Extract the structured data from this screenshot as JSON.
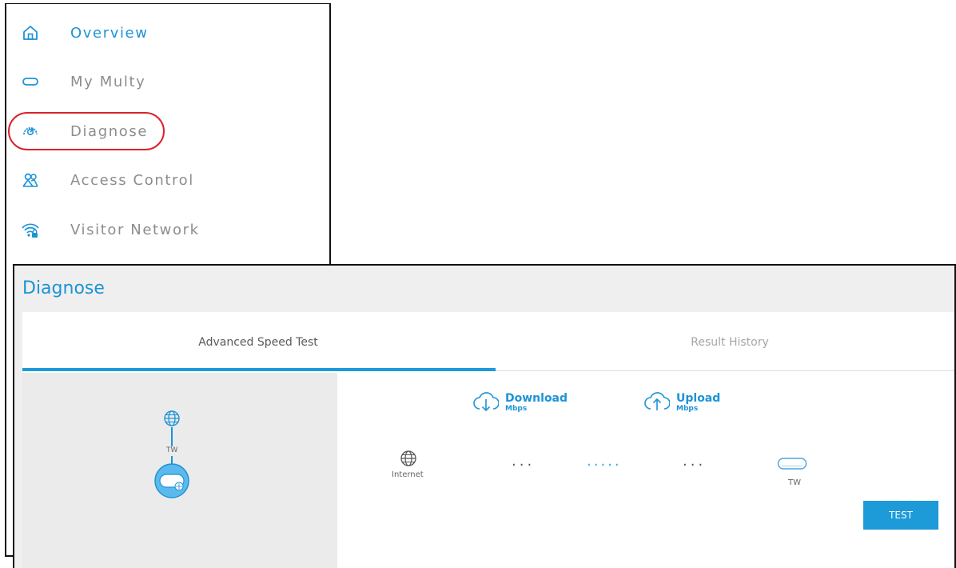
{
  "menu": {
    "items": [
      {
        "label": "Overview",
        "icon": "home-icon"
      },
      {
        "label": "My Multy",
        "icon": "router-icon"
      },
      {
        "label": "Diagnose",
        "icon": "speedometer-icon"
      },
      {
        "label": "Access Control",
        "icon": "users-icon"
      },
      {
        "label": "Visitor Network",
        "icon": "wifi-lock-icon"
      }
    ],
    "highlighted": "Diagnose",
    "highlight_color": "#d9232c"
  },
  "diagnose": {
    "title": "Diagnose",
    "tabs": [
      {
        "label": "Advanced Speed Test",
        "active": true
      },
      {
        "label": "Result History",
        "active": false
      }
    ],
    "topology": {
      "node_label": "TW"
    },
    "download": {
      "label": "Download",
      "unit": "Mbps",
      "icon": "cloud-download-icon"
    },
    "upload": {
      "label": "Upload",
      "unit": "Mbps",
      "icon": "cloud-upload-icon"
    },
    "path": {
      "internet_label": "Internet",
      "device_label": "TW",
      "dots": "...",
      "active_dots": "....."
    },
    "test_button": "TEST"
  },
  "colors": {
    "accent": "#1d93d6",
    "button": "#1d9ad8",
    "muted_text": "#8d8d8d"
  }
}
